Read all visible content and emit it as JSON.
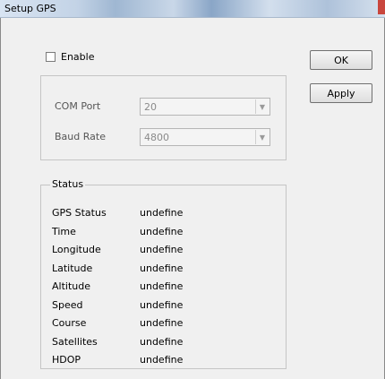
{
  "window": {
    "title": "Setup GPS"
  },
  "enable": {
    "label": "Enable",
    "checked": false
  },
  "buttons": {
    "ok": "OK",
    "apply": "Apply"
  },
  "settings": {
    "com_port": {
      "label": "COM Port",
      "value": "20"
    },
    "baud_rate": {
      "label": "Baud Rate",
      "value": "4800"
    }
  },
  "status": {
    "legend": "Status",
    "rows": [
      {
        "label": "GPS Status",
        "value": "undefine"
      },
      {
        "label": "Time",
        "value": "undefine"
      },
      {
        "label": "Longitude",
        "value": "undefine"
      },
      {
        "label": "Latitude",
        "value": "undefine"
      },
      {
        "label": "Altitude",
        "value": "undefine"
      },
      {
        "label": "Speed",
        "value": "undefine"
      },
      {
        "label": "Course",
        "value": "undefine"
      },
      {
        "label": "Satellites",
        "value": "undefine"
      },
      {
        "label": "HDOP",
        "value": "undefine"
      }
    ]
  }
}
